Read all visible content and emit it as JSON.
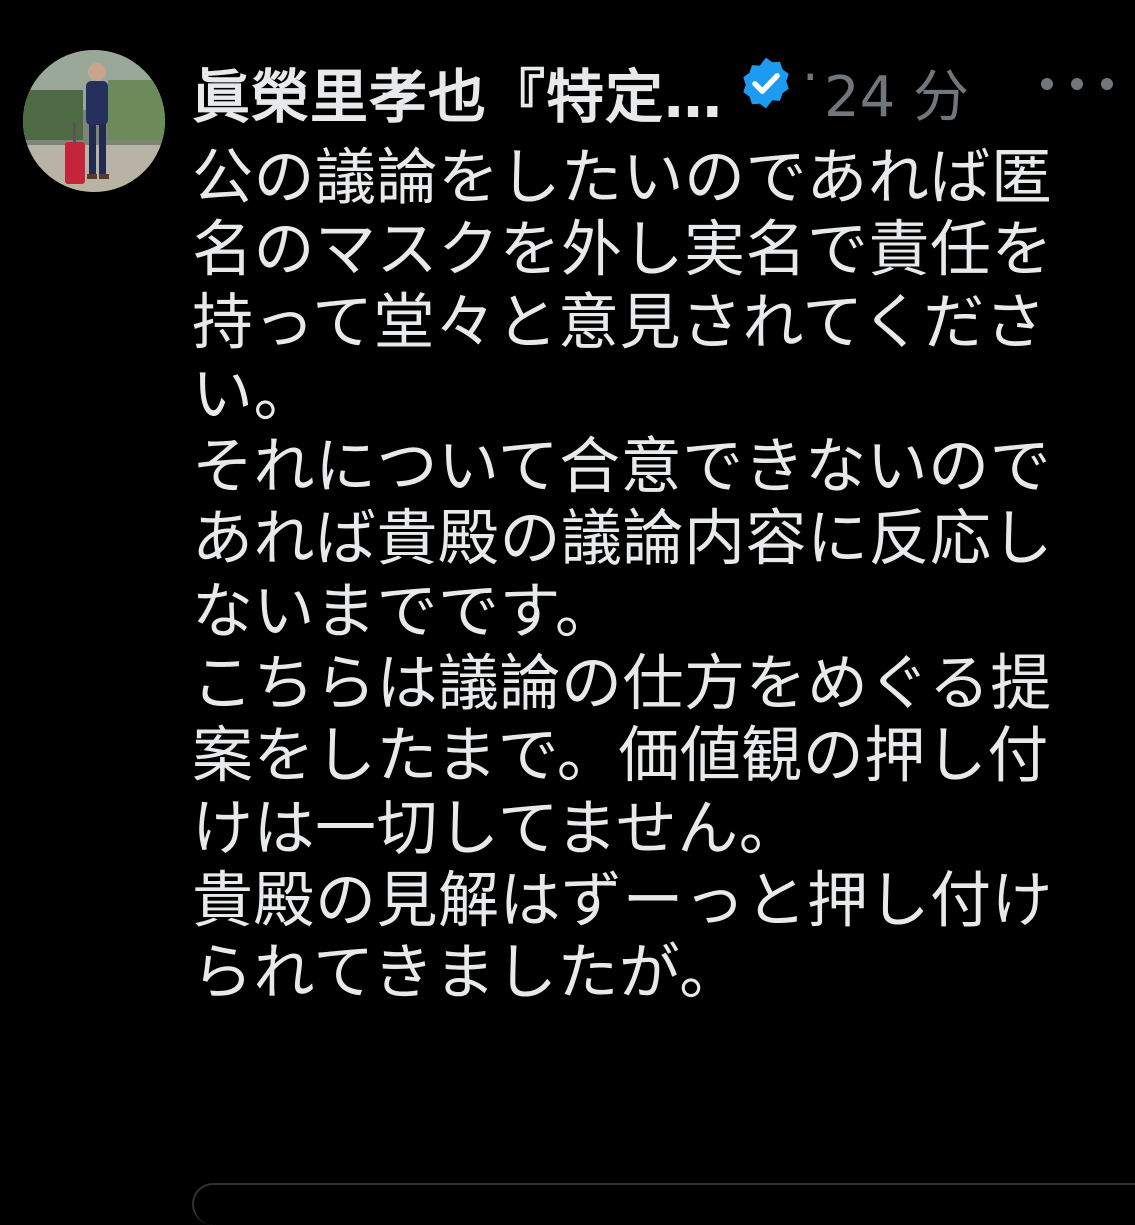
{
  "post": {
    "author": {
      "display_name": "眞榮里孝也『特定…",
      "verified": true,
      "verified_color": "#1d9bf0"
    },
    "separator": "·",
    "timestamp": "24 分",
    "body_lines": [
      "公の議論をしたいのであれば匿",
      "名のマスクを外し実名で責任を",
      "持って堂々と意見されてくださ",
      "い。",
      "それについて合意できないので",
      "あれば貴殿の議論内容に反応し",
      "ないまでです。",
      "こちらは議論の仕方をめぐる提",
      "案をしたまで。価値観の押し付",
      "けは一切してません。",
      "貴殿の見解はずーっと押し付け",
      "られてきましたが。"
    ]
  },
  "icons": {
    "verified": "verified-badge-icon",
    "more": "more-options-icon"
  },
  "colors": {
    "background": "#000000",
    "text": "#e7e9ea",
    "secondary_text": "#71767b",
    "accent": "#1d9bf0"
  }
}
